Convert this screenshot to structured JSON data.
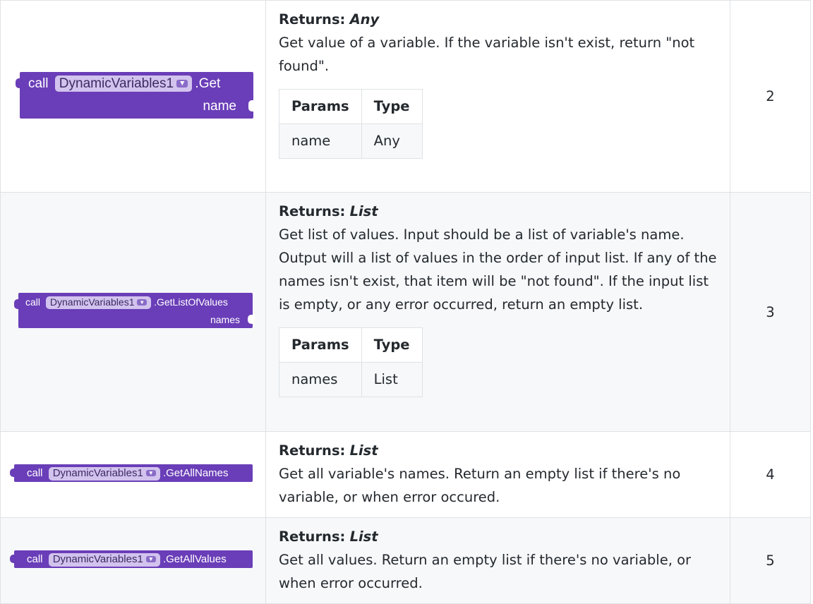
{
  "colors": {
    "block_purple": "#6a3eb8",
    "chip_bg": "#d2c3ee",
    "border": "#dfe2e5",
    "stripe": "#f6f8fa"
  },
  "params_header": {
    "params": "Params",
    "type": "Type"
  },
  "rows": [
    {
      "block": {
        "call": "call",
        "component": "DynamicVariables1",
        "dropdown_icon": "triangle-down",
        "method": ".Get",
        "param": "name"
      },
      "returns_label": "Returns:",
      "returns_type": "Any",
      "description": "Get value of a variable. If the variable isn't exist, return \"not found\".",
      "params": [
        {
          "name": "name",
          "type": "Any"
        }
      ],
      "version": "2"
    },
    {
      "block": {
        "call": "call",
        "component": "DynamicVariables1",
        "dropdown_icon": "triangle-down",
        "method": ".GetListOfValues",
        "param": "names"
      },
      "returns_label": "Returns:",
      "returns_type": "List",
      "description": "Get list of values. Input should be a list of variable's name. Output will a list of values in the order of input list. If any of the names isn't exist, that item will be \"not found\". If the input list is empty, or any error occurred, return an empty list.",
      "params": [
        {
          "name": "names",
          "type": "List"
        }
      ],
      "version": "3"
    },
    {
      "block": {
        "call": "call",
        "component": "DynamicVariables1",
        "dropdown_icon": "triangle-down",
        "method": ".GetAllNames"
      },
      "returns_label": "Returns:",
      "returns_type": "List",
      "description": "Get all variable's names. Return an empty list if there's no variable, or when error occured.",
      "version": "4"
    },
    {
      "block": {
        "call": "call",
        "component": "DynamicVariables1",
        "dropdown_icon": "triangle-down",
        "method": ".GetAllValues"
      },
      "returns_label": "Returns:",
      "returns_type": "List",
      "description": "Get all values. Return an empty list if there's no variable, or when error occurred.",
      "version": "5"
    }
  ]
}
